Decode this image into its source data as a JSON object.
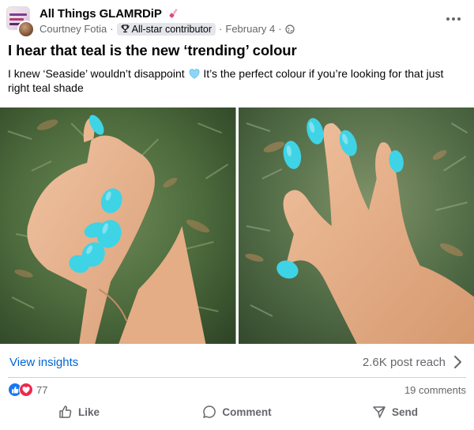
{
  "post": {
    "group_name": "All Things GLAMRDiP",
    "author": "Courtney Fotia",
    "badge_label": "All-star contributor",
    "date": "February 4",
    "separator": "·",
    "title": "I hear that teal is the new ‘trending’ colour",
    "body_before_emoji": "I knew ‘Seaside’ wouldn’t disappoint",
    "body_after_emoji": " It’s the perfect colour if you’re looking for that just right teal shade",
    "inline_emoji": "light-blue-heart-icon",
    "photos": [
      {
        "name": "hand-photo-left",
        "icon": "nail-photo"
      },
      {
        "name": "hand-photo-right",
        "icon": "nail-photo"
      }
    ]
  },
  "insights": {
    "view_label": "View insights",
    "reach_label": "2.6K post reach"
  },
  "engagement": {
    "reaction_count": "77",
    "comments_label": "19 comments",
    "reaction_icons": [
      "like-icon",
      "love-icon"
    ]
  },
  "actions": {
    "like_label": "Like",
    "comment_label": "Comment",
    "send_label": "Send"
  },
  "colors": {
    "link_blue": "#0064d1",
    "secondary_text": "#65676b",
    "like_blue": "#1877f2",
    "love_red": "#f0284a",
    "nail_teal": "#3fd3e6"
  }
}
